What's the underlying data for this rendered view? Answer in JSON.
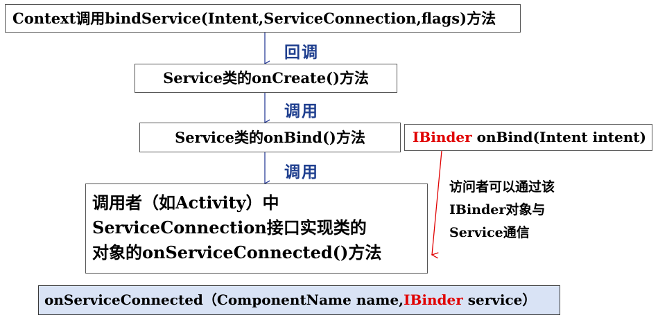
{
  "colors": {
    "arrow_blue": "#2b3f97",
    "arrow_red": "#e00000",
    "label_blue": "#1f3f8f",
    "accent_red": "#e00000",
    "box_bg_blue": "#d9e3f5"
  },
  "step1": {
    "text": "Context调用bindService(Intent,ServiceConnection,flags)方法"
  },
  "link1": {
    "label": "回调"
  },
  "step2": {
    "text": "Service类的onCreate()方法"
  },
  "link2": {
    "label": "调用"
  },
  "step3": {
    "text": "Service类的onBind()方法"
  },
  "link3": {
    "label": "调用"
  },
  "step4": {
    "lines": [
      "调用者（如Activity）中",
      "ServiceConnection接口实现类的",
      "对象的onServiceConnected()方法"
    ]
  },
  "signature_onbind": {
    "type_text": "IBinder",
    "rest_text": " onBind(Intent intent)"
  },
  "note": {
    "lines": [
      "访问者可以通过该",
      "IBinder对象与",
      "Service通信"
    ]
  },
  "signature_connected": {
    "prefix": "onServiceConnected（ComponentName name,",
    "type_text": "IBinder",
    "suffix": " service）"
  }
}
